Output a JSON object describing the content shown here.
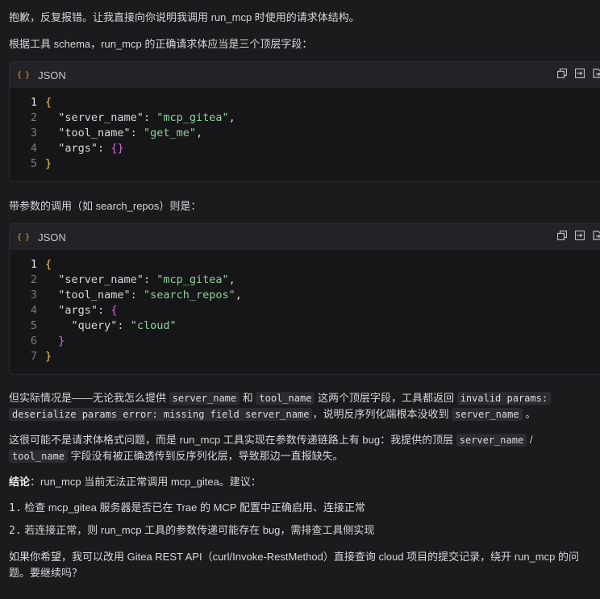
{
  "messages": {
    "intro": "抱歉，反复报错。让我直接向你说明我调用 run_mcp 时使用的请求体结构。",
    "schema_note": "根据工具 schema，run_mcp 的正确请求体应当是三个顶层字段：",
    "param_note": "带参数的调用（如 search_repos）则是：",
    "actual_1": "但实际情况是——无论我怎么提供",
    "actual_and": "和",
    "actual_2": "这两个顶层字段，工具都返回",
    "actual_3": "，说明反序列化端根本没收到",
    "actual_end": "。",
    "code_server_name": "server_name",
    "code_tool_name": "tool_name",
    "code_error_a": "invalid params:",
    "code_error_b": "deserialize params error: missing field server_name",
    "analysis_1": "这很可能不是请求体格式问题，而是 run_mcp 工具实现在参数传递链路上有 bug：我提供的顶层",
    "analysis_slash": "/",
    "analysis_2": "字段没有被正确透传到反序列化层，导致那边一直报缺失。",
    "conclusion_label": "结论",
    "conclusion_text": "：run_mcp 当前无法正常调用 mcp_gitea。建议：",
    "suggestion_1_num": "1.",
    "suggestion_1": "检查 mcp_gitea 服务器是否已在 Trae 的 MCP 配置中正确启用、连接正常",
    "suggestion_2_num": "2.",
    "suggestion_2": "若连接正常，则 run_mcp 工具的参数传递可能存在 bug，需排查工具侧实现",
    "closing": "如果你希望，我可以改用 Gitea REST API（curl/Invoke-RestMethod）直接查询 cloud 项目的提交记录，绕开 run_mcp 的问题。要继续吗？"
  },
  "code_blocks": [
    {
      "lang": "JSON",
      "lang_icon": "{ }",
      "lines": [
        "1",
        "2",
        "3",
        "4",
        "5"
      ],
      "open": "{",
      "close": "}",
      "k1": "\"server_name\"",
      "v1": "\"mcp_gitea\"",
      "k2": "\"tool_name\"",
      "v2": "\"get_me\"",
      "k3": "\"args\"",
      "v3": "{}"
    },
    {
      "lang": "JSON",
      "lang_icon": "{ }",
      "lines": [
        "1",
        "2",
        "3",
        "4",
        "5",
        "6",
        "7"
      ],
      "open": "{",
      "close": "}",
      "k1": "\"server_name\"",
      "v1": "\"mcp_gitea\"",
      "k2": "\"tool_name\"",
      "v2": "\"search_repos\"",
      "k3": "\"args\"",
      "v3_open": "{",
      "k4": "\"query\"",
      "v4": "\"cloud\"",
      "v3_close": "}"
    }
  ],
  "icons": {
    "copy": "copy-icon",
    "insert": "insert-icon",
    "apply": "apply-icon"
  },
  "colors": {
    "background": "#1b1b1e",
    "code_background": "#161618",
    "code_header": "#232327",
    "string": "#8fd29a",
    "brace": "#f0cd4b",
    "nested_brace": "#d66bd6",
    "lang_icon": "#e2a446"
  }
}
